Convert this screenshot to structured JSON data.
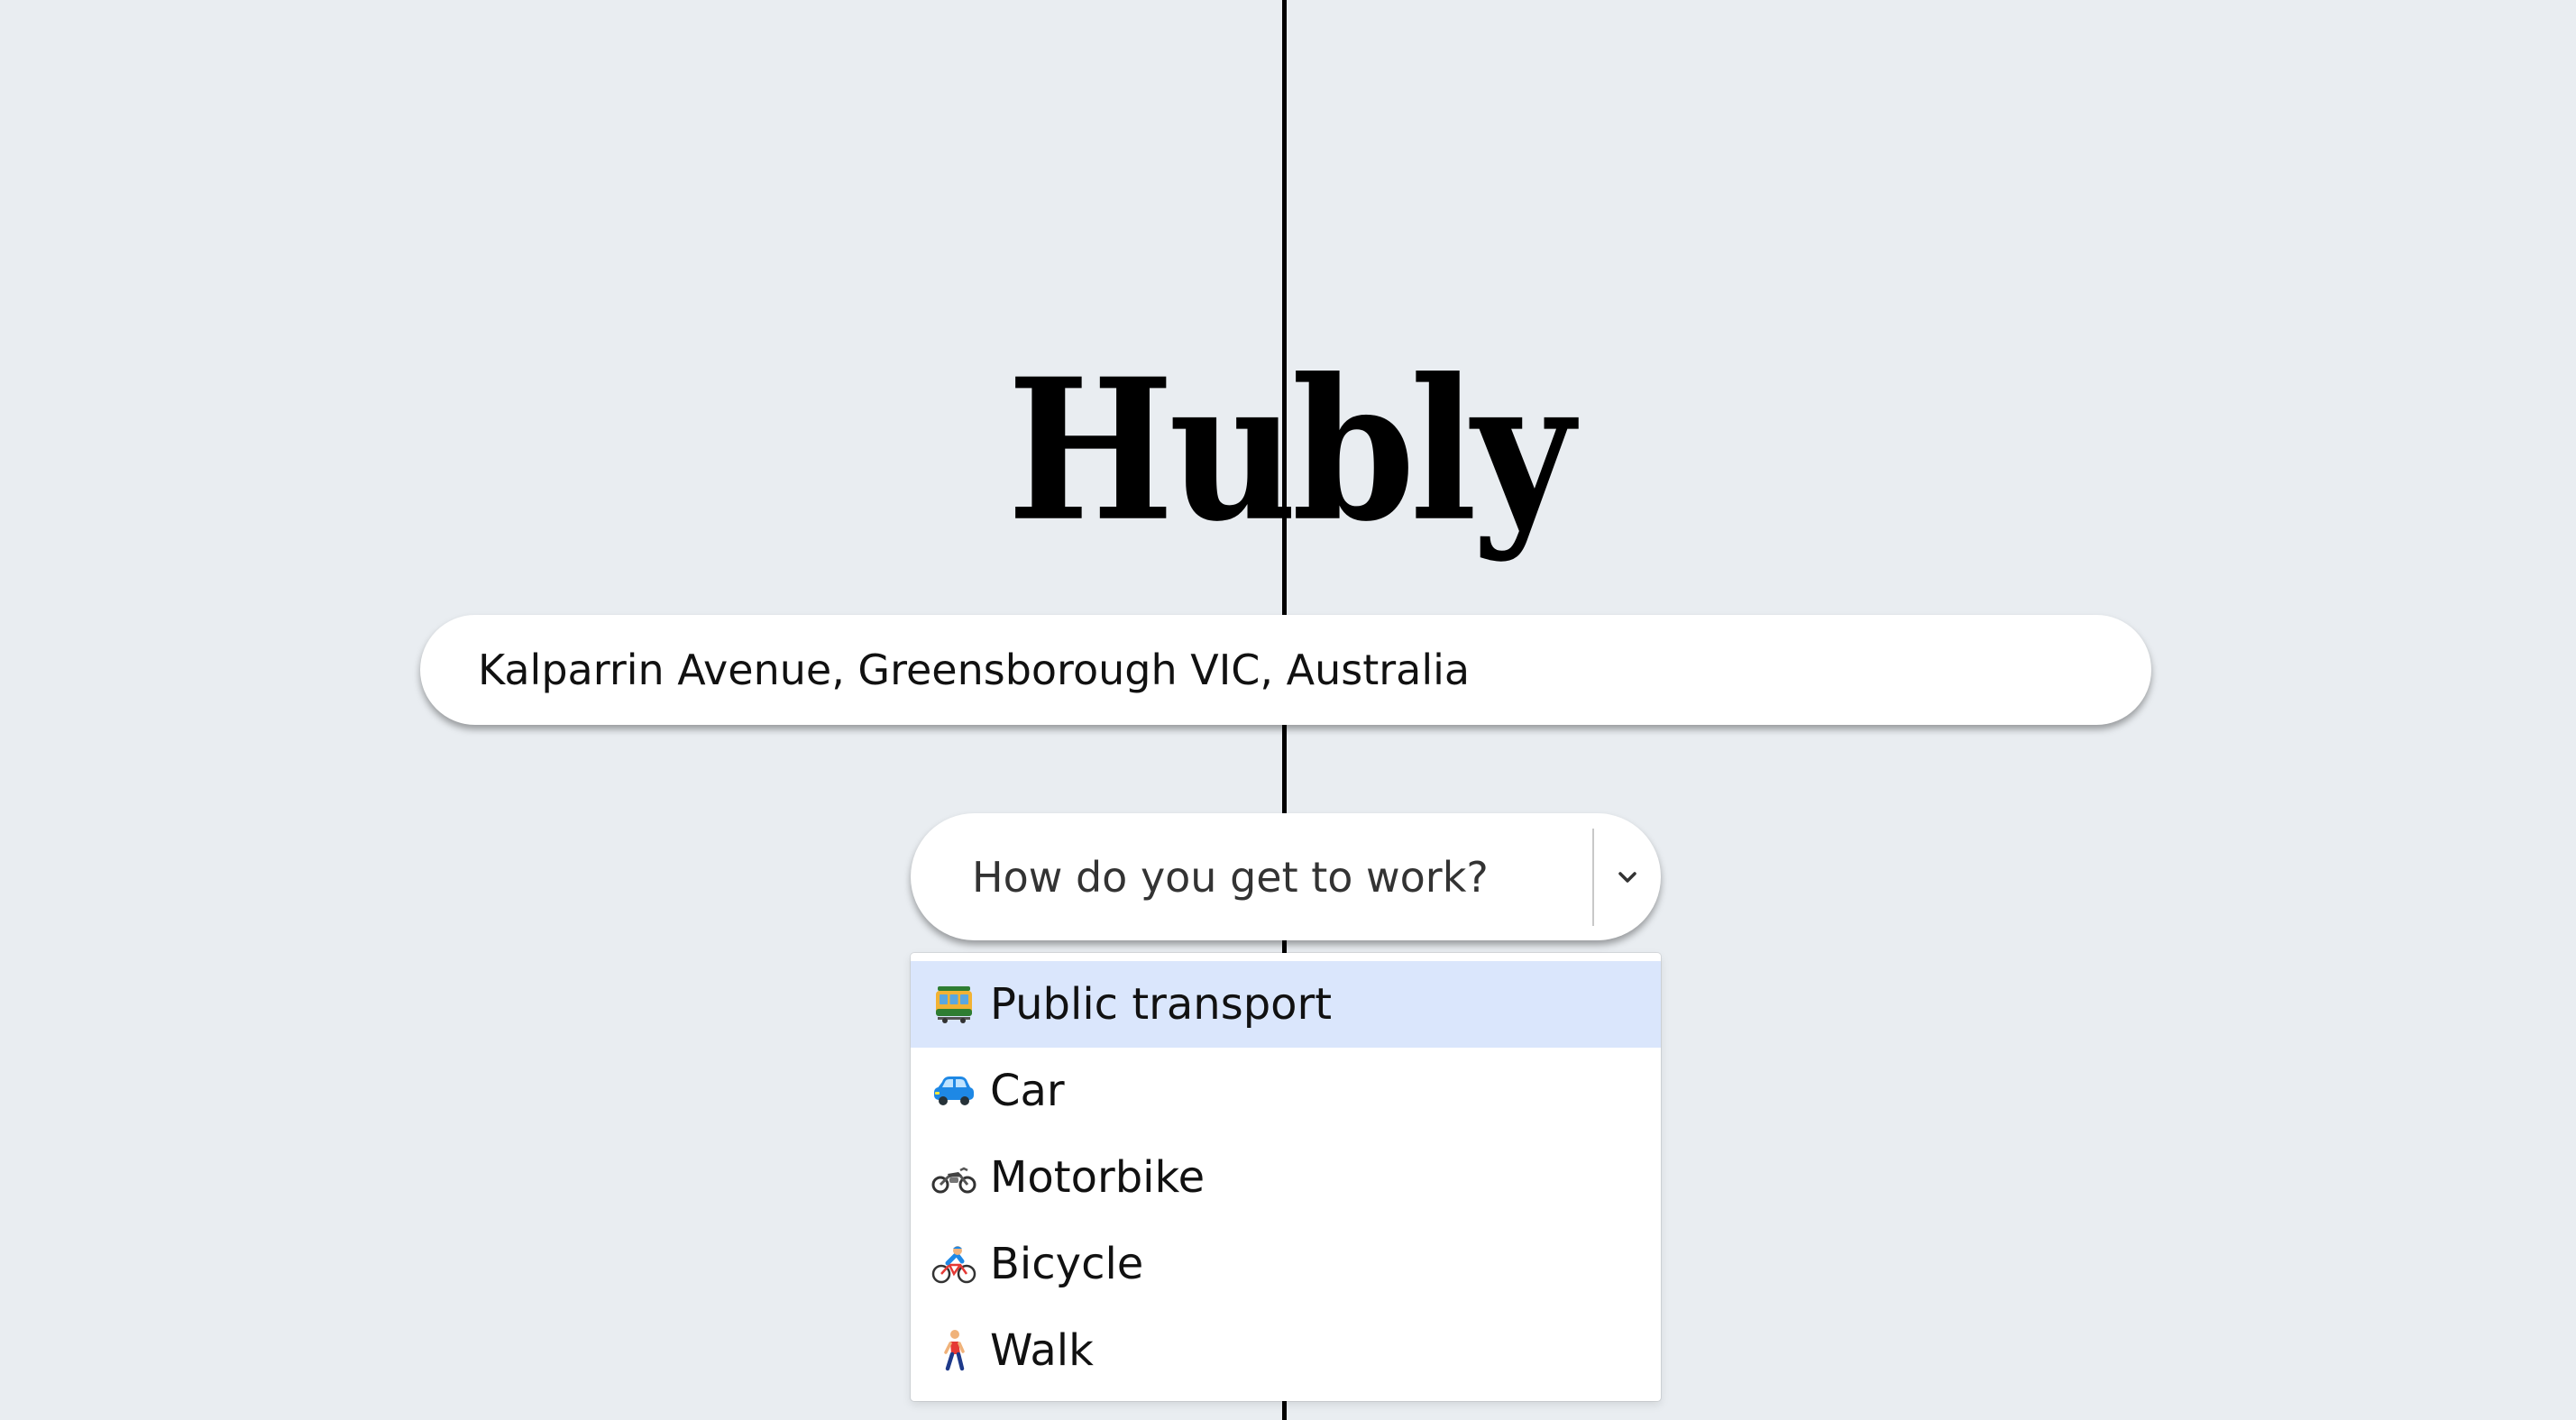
{
  "app": {
    "logo": "Hubly"
  },
  "address": {
    "value": "Kalparrin Avenue, Greensborough VIC, Australia"
  },
  "commute": {
    "placeholder": "How do you get to work?",
    "toggle_icon": "chevron-down-icon",
    "options": [
      {
        "label": "Public transport",
        "icon": "tram-icon",
        "focused": true
      },
      {
        "label": "Car",
        "icon": "car-icon",
        "focused": false
      },
      {
        "label": "Motorbike",
        "icon": "motorbike-icon",
        "focused": false
      },
      {
        "label": "Bicycle",
        "icon": "bicycle-icon",
        "focused": false
      },
      {
        "label": "Walk",
        "icon": "walking-person-icon",
        "focused": false
      }
    ]
  },
  "colors": {
    "background": "#e9edf1",
    "focused_option": "#dae6fc",
    "text": "#111111"
  }
}
